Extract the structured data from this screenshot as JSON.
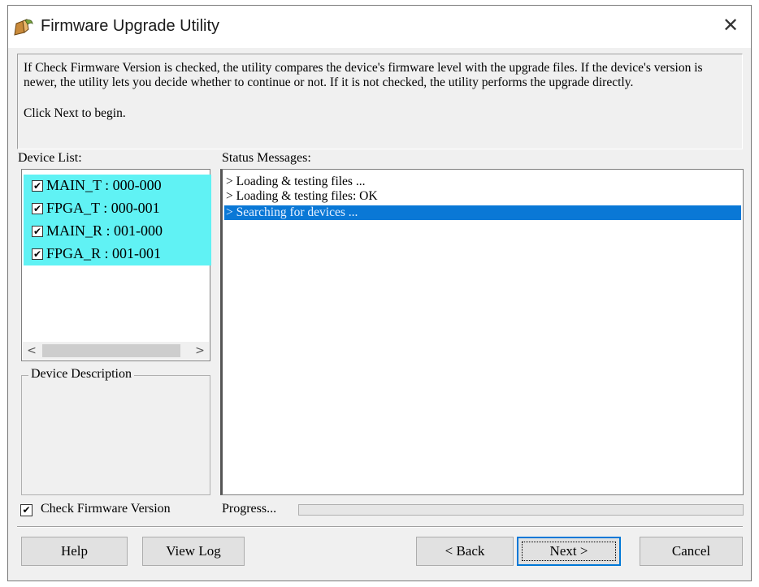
{
  "window": {
    "title": "Firmware Upgrade Utility",
    "close_glyph": "✕"
  },
  "icons": {
    "app": "firmware-upgrade-app-icon",
    "close": "close-icon",
    "checkmark": "checkmark-icon"
  },
  "info": {
    "text": "If Check Firmware Version is checked, the utility compares the device's firmware level with the upgrade files. If the device's version is newer, the utility lets you decide whether to continue or not. If it is not checked, the utility performs the upgrade directly.",
    "prompt": "Click Next to begin."
  },
  "device_list": {
    "label": "Device List:",
    "items": [
      {
        "label": "MAIN_T : 000-000",
        "checked": true
      },
      {
        "label": "FPGA_T : 000-001",
        "checked": true
      },
      {
        "label": "MAIN_R : 001-000",
        "checked": true
      },
      {
        "label": "FPGA_R : 001-001",
        "checked": true
      }
    ],
    "scroll_left": "<",
    "scroll_right": ">"
  },
  "device_description": {
    "label": "Device Description"
  },
  "status_messages": {
    "label": "Status Messages:",
    "messages": [
      {
        "text": "> Loading & testing files ...",
        "selected": false
      },
      {
        "text": "> Loading & testing files: OK",
        "selected": false
      },
      {
        "text": "> Searching for devices ...",
        "selected": true
      }
    ]
  },
  "check_firmware": {
    "label": "Check Firmware Version",
    "checked": true
  },
  "progress": {
    "label": "Progress...",
    "value": 0
  },
  "buttons": {
    "help": "Help",
    "view_log": "View Log",
    "back": "< Back",
    "next": "Next >",
    "cancel": "Cancel"
  },
  "colors": {
    "window_bg": "#f0f0f0",
    "list_highlight": "#60f2f4",
    "selection": "#0a78d6"
  }
}
